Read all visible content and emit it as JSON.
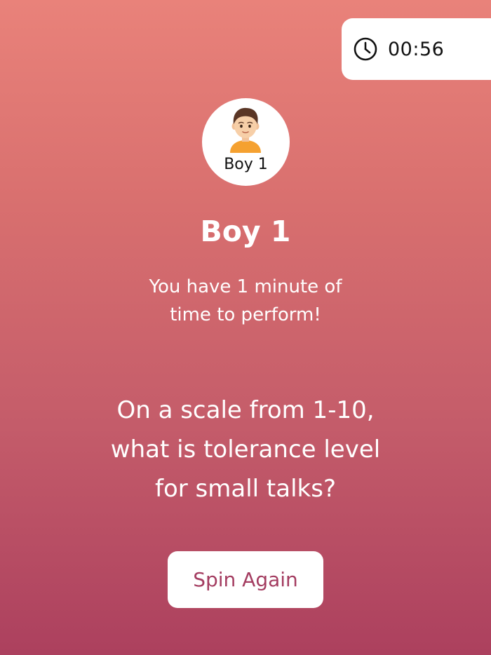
{
  "timer": {
    "icon": "clock-icon",
    "value": "00:56"
  },
  "player": {
    "avatar_icon": "boy-avatar-icon",
    "avatar_label": "Boy 1",
    "name": "Boy 1"
  },
  "instruction": "You have 1 minute of\ntime to perform!",
  "question": "On a scale from 1-10,\nwhat is tolerance level\nfor small talks?",
  "actions": {
    "spin_again_label": "Spin Again"
  },
  "colors": {
    "gradient_top": "#e9827a",
    "gradient_bottom": "#ac405e",
    "button_text": "#a43d61"
  }
}
